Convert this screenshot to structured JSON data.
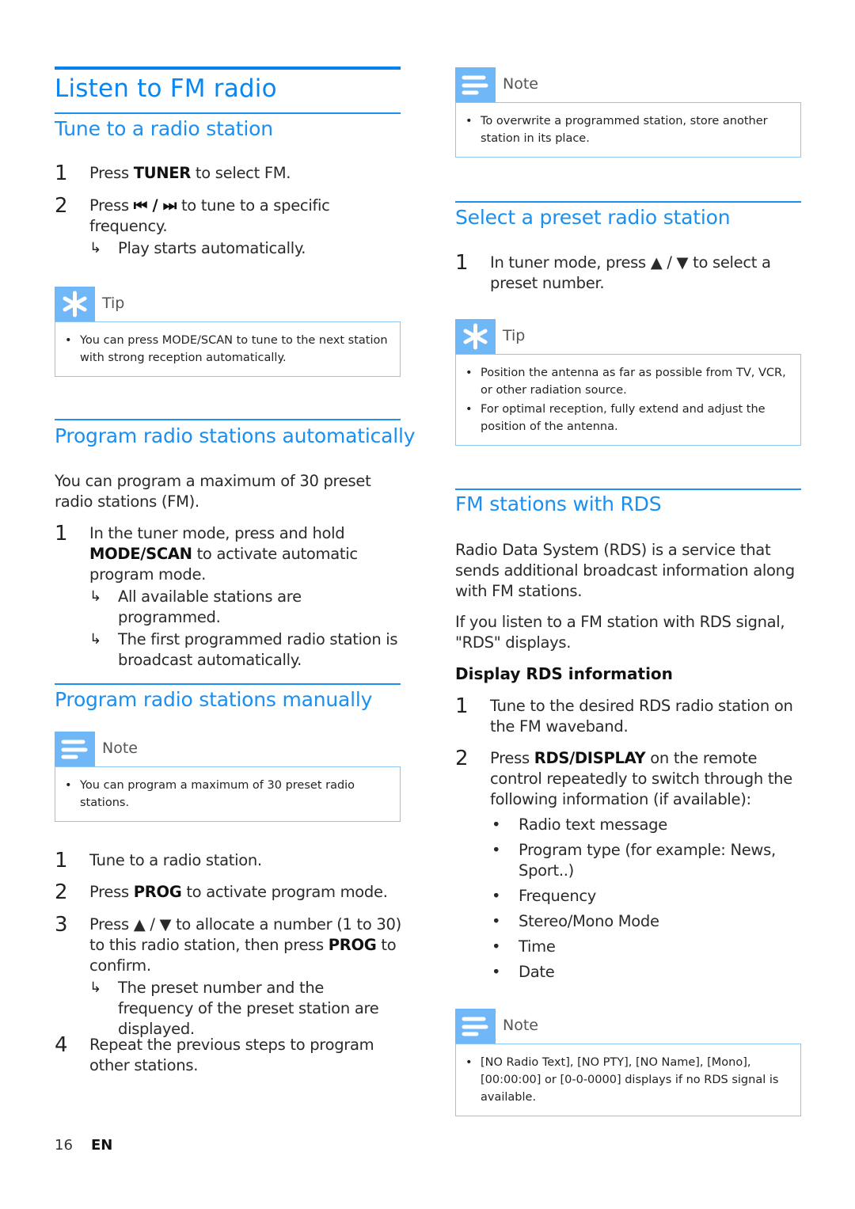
{
  "colors": {
    "heading_blue": "#0a86f0",
    "callout_icon_bg": "#6fb7f7",
    "callout_border": "#8cc6f7"
  },
  "left": {
    "title": "Listen to FM radio",
    "tune": {
      "heading": "Tune to a radio station",
      "steps": [
        {
          "num": "1",
          "pre": "Press ",
          "key": "TUNER",
          "post": " to select FM."
        },
        {
          "num": "2",
          "pre": "Press ",
          "key": "⏮ / ⏭",
          "post": " to tune to a specific frequency.",
          "result": "Play starts automatically."
        }
      ],
      "tip": {
        "label": "Tip",
        "icon": "asterisk-tip-icon",
        "items": [
          "You can press MODE/SCAN to tune to the next station with strong reception automatically."
        ]
      }
    },
    "auto": {
      "heading": "Program radio stations automatically",
      "intro": "You can program a maximum of 30 preset radio stations (FM).",
      "steps": [
        {
          "num": "1",
          "pre": "In the tuner mode, press and hold ",
          "key": "MODE/SCAN",
          "post": " to activate automatic program mode.",
          "results": [
            "All available stations are programmed.",
            "The first programmed radio station is broadcast automatically."
          ]
        }
      ]
    },
    "manual": {
      "heading": "Program radio stations manually",
      "note": {
        "label": "Note",
        "icon": "note-lines-icon",
        "items": [
          "You can program a maximum of 30 preset radio stations."
        ]
      },
      "steps": [
        {
          "num": "1",
          "text": "Tune to a radio station."
        },
        {
          "num": "2",
          "pre": "Press ",
          "key": "PROG",
          "post": " to activate program mode."
        },
        {
          "num": "3",
          "pre": "Press ▲ / ▼ to allocate a number (1 to 30) to this radio station, then press ",
          "key": "PROG",
          "post": " to confirm.",
          "result": "The preset number and the frequency of the preset station are displayed."
        },
        {
          "num": "4",
          "text": "Repeat the previous steps to program other stations."
        }
      ]
    }
  },
  "right": {
    "note_top": {
      "label": "Note",
      "icon": "note-lines-icon",
      "items": [
        "To overwrite a programmed station, store another station in its place."
      ]
    },
    "preset": {
      "heading": "Select a preset radio station",
      "steps": [
        {
          "num": "1",
          "text": "In tuner mode, press ▲ / ▼ to select a preset number."
        }
      ],
      "tip": {
        "label": "Tip",
        "icon": "asterisk-tip-icon",
        "items": [
          "Position the antenna as far as possible from TV, VCR, or other radiation source.",
          "For optimal reception, fully extend and adjust the position of the antenna."
        ]
      }
    },
    "rds": {
      "heading": "FM stations with RDS",
      "para1": "Radio Data System (RDS) is a service that sends additional broadcast information along with FM stations.",
      "para2": "If you listen to a FM station with RDS signal, \"RDS\" displays.",
      "subheading": "Display RDS information",
      "steps": [
        {
          "num": "1",
          "text": "Tune to the desired RDS radio station on the FM waveband."
        },
        {
          "num": "2",
          "pre": "Press ",
          "key": "RDS/DISPLAY",
          "post": " on the remote control repeatedly to switch through the following information (if available):",
          "bullets": [
            "Radio text message",
            "Program type (for example: News, Sport..)",
            "Frequency",
            "Stereo/Mono Mode",
            "Time",
            "Date"
          ]
        }
      ],
      "note": {
        "label": "Note",
        "icon": "note-lines-icon",
        "items": [
          "[NO Radio Text], [NO PTY], [NO Name], [Mono], [00:00:00] or [0-0-0000] displays if no RDS signal is available."
        ]
      }
    }
  },
  "footer": {
    "page_number": "16",
    "language": "EN"
  }
}
